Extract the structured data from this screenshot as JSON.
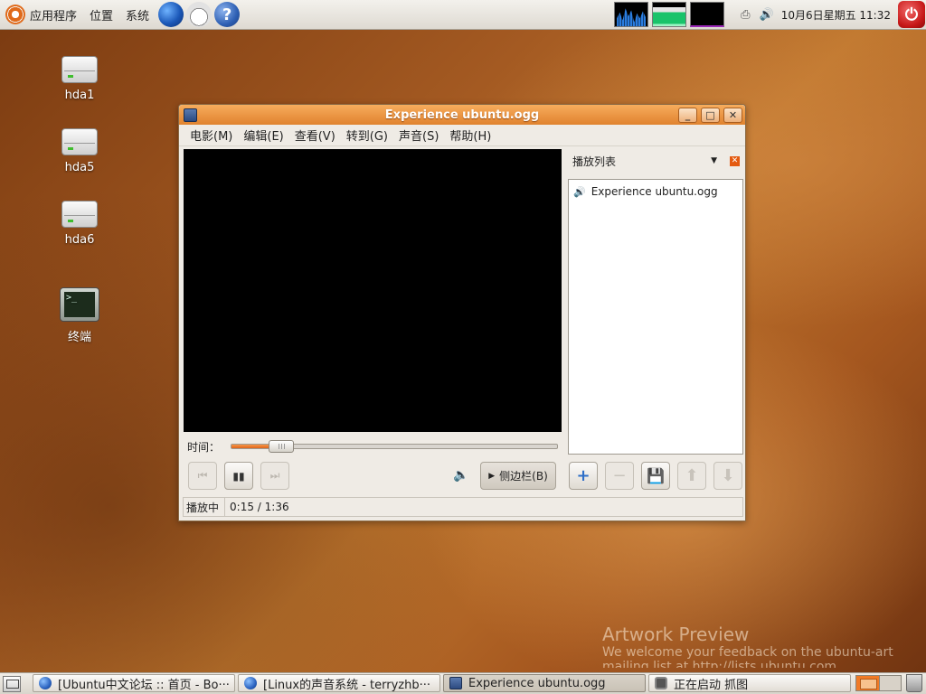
{
  "top_panel": {
    "menus": [
      "应用程序",
      "位置",
      "系统"
    ],
    "launchers": [
      {
        "icon": "web-browser-icon",
        "glyph": ""
      },
      {
        "icon": "clock-icon",
        "glyph": ""
      },
      {
        "icon": "help-icon",
        "glyph": "?"
      }
    ],
    "clock": "10月6日星期五 11:32"
  },
  "desktop": {
    "icons": [
      {
        "label": "hda1"
      },
      {
        "label": "hda5"
      },
      {
        "label": "hda6"
      },
      {
        "label": "终端",
        "screen": ">_"
      }
    ]
  },
  "window": {
    "title": "Experience ubuntu.ogg",
    "controls": {
      "minimize": "_",
      "maximize": "□",
      "close": "✕"
    },
    "menus": [
      "电影(M)",
      "编辑(E)",
      "查看(V)",
      "转到(G)",
      "声音(S)",
      "帮助(H)"
    ],
    "time_label": "时间：",
    "seek_fraction": 0.153,
    "buttons": {
      "previous": "⏮",
      "pause": "▮▮",
      "next": "⏭",
      "volume": "🔈"
    },
    "sidebar_button": {
      "arrow": "▶",
      "label": "侧边栏(B)"
    },
    "playlist": {
      "title": "播放列表",
      "dropdown": "▼",
      "close": "✕",
      "items": [
        {
          "speaker": "🔊",
          "name": "Experience ubuntu.ogg"
        }
      ],
      "buttons": {
        "add": "+",
        "remove": "−",
        "save": "💾",
        "up": "⬆",
        "down": "⬇"
      }
    },
    "status": {
      "state": "播放中",
      "time": "0:15 / 1:36"
    }
  },
  "watermark": {
    "title": "Artwork Preview",
    "line1": "We welcome your feedback on the ubuntu-art",
    "line2": "mailing list at http://lists.ubuntu.com"
  },
  "taskbar": {
    "tasks": [
      {
        "label": "[Ubuntu中文论坛 :: 首页 - Bo···"
      },
      {
        "label": "[Linux的声音系统 - terryzhb···"
      },
      {
        "label": "Experience ubuntu.ogg"
      },
      {
        "label": "正在启动 抓图"
      }
    ]
  }
}
